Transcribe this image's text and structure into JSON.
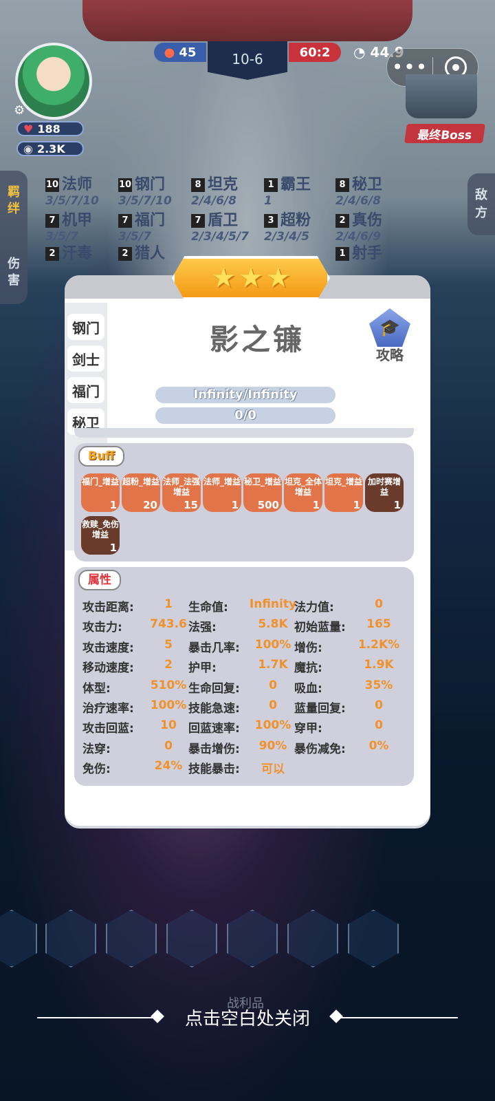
{
  "hud": {
    "hp": "188",
    "gold": "2.3K",
    "score_blue": "45",
    "stage": "10-6",
    "timer": "60:2",
    "round": "44.9",
    "boss_label": "最终Boss",
    "menu_more": "•••"
  },
  "left_tabs": [
    "羁绊",
    "伤害"
  ],
  "right_tab": "敌方",
  "traits": [
    {
      "num": "10",
      "name": "法师",
      "levels": "3/5/7/10"
    },
    {
      "num": "10",
      "name": "钢门",
      "levels": "3/5/7/10"
    },
    {
      "num": "8",
      "name": "坦克",
      "levels": "2/4/6/8"
    },
    {
      "num": "1",
      "name": "霸王",
      "levels": "1"
    },
    {
      "num": "8",
      "name": "秘卫",
      "levels": "2/4/6/8"
    },
    {
      "num": "7",
      "name": "机甲",
      "levels": "3/5/7"
    },
    {
      "num": "7",
      "name": "福门",
      "levels": "3/5/7"
    },
    {
      "num": "7",
      "name": "盾卫",
      "levels": "2/3/4/5/7"
    },
    {
      "num": "3",
      "name": "超粉",
      "levels": "2/3/4/5"
    },
    {
      "num": "2",
      "name": "真伤",
      "levels": "2/4/6/9"
    },
    {
      "num": "2",
      "name": "汗毒",
      "levels": ""
    },
    {
      "num": "2",
      "name": "猎人",
      "levels": ""
    },
    {
      "num": "1",
      "name": "射手",
      "levels": ""
    }
  ],
  "card": {
    "stars": 3,
    "hero_name": "影之镰",
    "guide_label": "攻略",
    "hp_bar": "Infinity/Infinity",
    "mp_bar": "0/0",
    "side_tabs": [
      "钢门",
      "剑士",
      "福门",
      "秘卫"
    ],
    "buff_title": "Buff",
    "buffs": [
      {
        "label": "福门_增益",
        "count": "1",
        "dark": false
      },
      {
        "label": "超粉_增益",
        "count": "20",
        "dark": false
      },
      {
        "label": "法师_法强增益",
        "count": "15",
        "dark": false
      },
      {
        "label": "法师_增益",
        "count": "1",
        "dark": false
      },
      {
        "label": "秘卫_增益",
        "count": "500",
        "dark": false
      },
      {
        "label": "坦克_全体增益",
        "count": "1",
        "dark": false
      },
      {
        "label": "坦克_增益",
        "count": "1",
        "dark": false
      },
      {
        "label": "加时赛增益",
        "count": "1",
        "dark": true
      },
      {
        "label": "救赎_免伤增益",
        "count": "1",
        "dark": true
      }
    ],
    "attr_title": "属性",
    "attributes": [
      [
        [
          "攻击距离:",
          "1"
        ],
        [
          "生命值:",
          "Infinity"
        ],
        [
          "法力值:",
          "0"
        ]
      ],
      [
        [
          "攻击力:",
          "743.6"
        ],
        [
          "法强:",
          "5.8K"
        ],
        [
          "初始蓝量:",
          "165"
        ]
      ],
      [
        [
          "攻击速度:",
          "5"
        ],
        [
          "暴击几率:",
          "100%"
        ],
        [
          "增伤:",
          "1.2K%"
        ]
      ],
      [
        [
          "移动速度:",
          "2"
        ],
        [
          "护甲:",
          "1.7K"
        ],
        [
          "魔抗:",
          "1.9K"
        ]
      ],
      [
        [
          "体型:",
          "510%"
        ],
        [
          "生命回复:",
          "0"
        ],
        [
          "吸血:",
          "35%"
        ]
      ],
      [
        [
          "治疗速率:",
          "100%"
        ],
        [
          "技能急速:",
          "0"
        ],
        [
          "蓝量回复:",
          "0"
        ]
      ],
      [
        [
          "攻击回蓝:",
          "10"
        ],
        [
          "回蓝速率:",
          "100%"
        ],
        [
          "穿甲:",
          "0"
        ]
      ],
      [
        [
          "法穿:",
          "0"
        ],
        [
          "暴击增伤:",
          "90%"
        ],
        [
          "暴伤减免:",
          "0%"
        ]
      ],
      [
        [
          "免伤:",
          "24%"
        ],
        [
          "技能暴击:",
          "可以"
        ],
        null
      ]
    ]
  },
  "close_hint": "点击空白处关闭",
  "bottom_label": "战利品",
  "colors": {
    "accent_orange": "#f0912b",
    "buff_orange": "#e2744a",
    "red": "#c9323a",
    "blue": "#3a5ea9"
  }
}
